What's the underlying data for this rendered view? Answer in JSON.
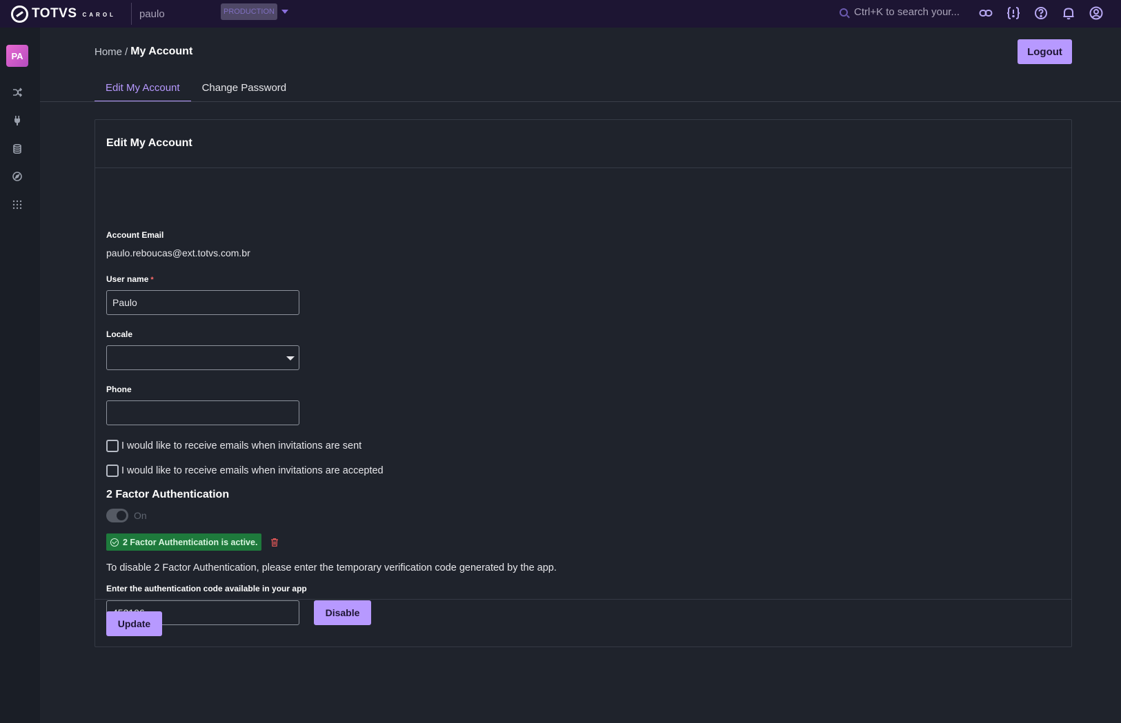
{
  "topbar": {
    "logo_text": "TOTVS",
    "logo_sub": "CAROL",
    "tenant": "paulo",
    "environment": "PRODUCTION",
    "search_placeholder": "Ctrl+K to search your...",
    "icons": [
      "link-icon",
      "code-braces-icon",
      "help-icon",
      "bell-icon",
      "user-circle-icon"
    ]
  },
  "sidebar": {
    "avatar_initials": "PA",
    "icons": [
      "shuffle-icon",
      "plug-icon",
      "database-icon",
      "compass-icon",
      "apps-grid-icon"
    ]
  },
  "breadcrumb": {
    "home": "Home",
    "separator": "/",
    "current": "My Account"
  },
  "actions": {
    "logout_label": "Logout"
  },
  "tabs": [
    {
      "label": "Edit My Account",
      "active": true
    },
    {
      "label": "Change Password",
      "active": false
    }
  ],
  "form": {
    "title": "Edit My Account",
    "account_email_label": "Account Email",
    "account_email_value": "paulo.reboucas@ext.totvs.com.br",
    "username_label": "User name",
    "username_required_mark": "*",
    "username_value": "Paulo",
    "locale_label": "Locale",
    "locale_value": "",
    "phone_label": "Phone",
    "phone_value": "",
    "checkbox_sent_label": "I would like to receive emails when invitations are sent",
    "checkbox_sent_checked": false,
    "checkbox_accepted_label": "I would like to receive emails when invitations are accepted",
    "checkbox_accepted_checked": false,
    "twofa_heading": "2 Factor Authentication",
    "twofa_toggle_label": "On",
    "twofa_status": "2 Factor Authentication is active.",
    "twofa_help": "To disable 2 Factor Authentication, please enter the temporary verification code generated by the app.",
    "auth_code_label": "Enter the authentication code available in your app",
    "auth_code_value": "453106",
    "disable_label": "Disable",
    "update_label": "Update"
  },
  "colors": {
    "accent": "#b799ff",
    "topbar_bg": "#1d1533",
    "page_bg": "#1f232c",
    "success_badge": "#1e7a3c",
    "danger": "#e05757"
  }
}
